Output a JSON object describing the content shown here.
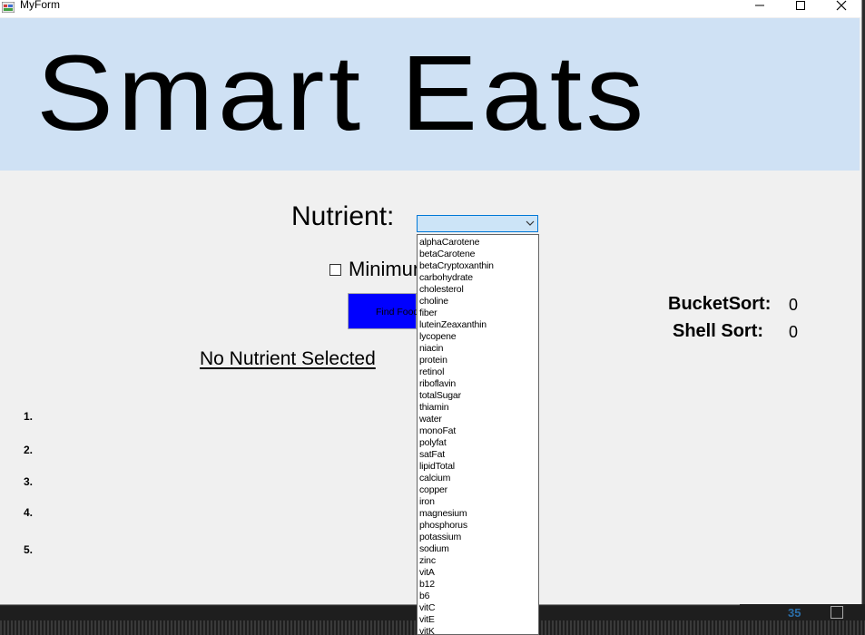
{
  "window": {
    "title": "MyForm"
  },
  "banner": {
    "title": "Smart Eats"
  },
  "form": {
    "nutrient_label": "Nutrient:",
    "combo_value": "",
    "checkbox_label": "Minimum",
    "checkbox_checked": false,
    "find_button_label": "Find Foods",
    "status_text": "No Nutrient Selected"
  },
  "dropdown": {
    "items": [
      "alphaCarotene",
      "betaCarotene",
      "betaCryptoxanthin",
      "carbohydrate",
      "cholesterol",
      "choline",
      "fiber",
      "luteinZeaxanthin",
      "lycopene",
      "niacin",
      "protein",
      "retinol",
      "riboflavin",
      "totalSugar",
      "thiamin",
      "water",
      "monoFat",
      "polyfat",
      "satFat",
      "lipidTotal",
      "calcium",
      "copper",
      "iron",
      "magnesium",
      "phosphorus",
      "potassium",
      "sodium",
      "zinc",
      "vitA",
      "b12",
      "b6",
      "vitC",
      "vitE",
      "vitK"
    ]
  },
  "sorts": {
    "bucket_label": "BucketSort:",
    "bucket_value": "0",
    "shell_label": "Shell Sort:",
    "shell_value": "0"
  },
  "results": {
    "ranks": [
      "1.",
      "2.",
      "3.",
      "4.",
      "5."
    ]
  },
  "background": {
    "line_number": "35"
  },
  "colors": {
    "banner": "#cfe1f4",
    "button": "#0000ff",
    "combo_focus": "#0078d7"
  }
}
